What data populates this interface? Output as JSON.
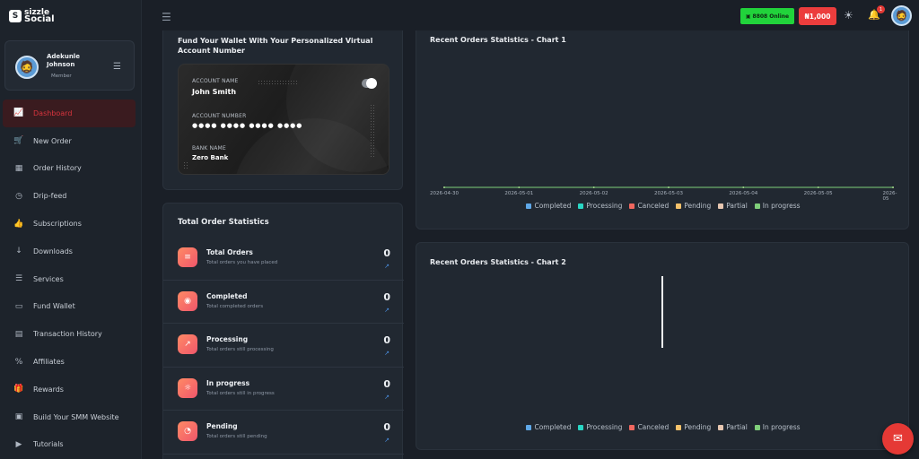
{
  "brand": {
    "logo_top": "sizzle",
    "logo_bottom": "Social",
    "logo_mark": "S"
  },
  "user": {
    "name": "Adekunle Johnson",
    "role": "Member"
  },
  "sidebar": {
    "items": [
      {
        "label": "Dashboard",
        "icon": "chart-icon",
        "glyph": "📈"
      },
      {
        "label": "New Order",
        "icon": "cart-icon",
        "glyph": "🛒"
      },
      {
        "label": "Order History",
        "icon": "calendar-icon",
        "glyph": "▦"
      },
      {
        "label": "Drip-feed",
        "icon": "clock-icon",
        "glyph": "◷"
      },
      {
        "label": "Subscriptions",
        "icon": "thumbs-up-icon",
        "glyph": "👍"
      },
      {
        "label": "Downloads",
        "icon": "download-icon",
        "glyph": "↓"
      },
      {
        "label": "Services",
        "icon": "list-icon",
        "glyph": "☰"
      },
      {
        "label": "Fund Wallet",
        "icon": "wallet-icon",
        "glyph": "▭"
      },
      {
        "label": "Transaction History",
        "icon": "file-icon",
        "glyph": "▤"
      },
      {
        "label": "Affiliates",
        "icon": "percent-icon",
        "glyph": "%"
      },
      {
        "label": "Rewards",
        "icon": "gift-icon",
        "glyph": "🎁"
      },
      {
        "label": "Build Your SMM Website",
        "icon": "build-icon",
        "glyph": "▣"
      },
      {
        "label": "Tutorials",
        "icon": "play-circle-icon",
        "glyph": "▶"
      }
    ]
  },
  "topbar": {
    "online_count": "8808 Online",
    "balance": "₦1,000",
    "notification_count": "1"
  },
  "wallet": {
    "title": "Fund Your Wallet With Your Personalized Virtual Account Number",
    "account_name_label": "ACCOUNT NAME",
    "account_name": "John Smith",
    "account_number_label": "ACCOUNT NUMBER",
    "account_number_masked": "●●●● ●●●● ●●●● ●●●●",
    "bank_name_label": "BANK NAME",
    "bank_name": "Zero Bank"
  },
  "stats": {
    "title": "Total Order Statistics",
    "rows": [
      {
        "name": "Total Orders",
        "desc": "Total orders you have placed",
        "value": "0",
        "icon": "list-icon",
        "glyph": "≡"
      },
      {
        "name": "Completed",
        "desc": "Total completed orders",
        "value": "0",
        "icon": "check-icon",
        "glyph": "◉"
      },
      {
        "name": "Processing",
        "desc": "Total orders still processing",
        "value": "0",
        "icon": "trend-icon",
        "glyph": "↗"
      },
      {
        "name": "In progress",
        "desc": "Total orders still in progress",
        "value": "0",
        "icon": "sun-icon",
        "glyph": "☼"
      },
      {
        "name": "Pending",
        "desc": "Total orders still pending",
        "value": "0",
        "icon": "timer-icon",
        "glyph": "◔"
      }
    ]
  },
  "colors": {
    "completed": "#5fa8e8",
    "processing": "#29d6c4",
    "canceled": "#f0675f",
    "pending": "#f5c26b",
    "partial": "#e6c6b0",
    "in_progress": "#7fcf7a"
  },
  "chart_data": [
    {
      "type": "line",
      "title": "Recent Orders Statistics - Chart 1",
      "x": [
        "2026-04-30",
        "2026-05-01",
        "2026-05-02",
        "2026-05-03",
        "2026-05-04",
        "2026-05-05",
        "2026-05-06"
      ],
      "x_tick_labels": [
        "2026-04-30",
        "2026-05-01",
        "2026-05-02",
        "2026-05-03",
        "2026-05-04",
        "2026-05-05",
        "2026-05"
      ],
      "series": [
        {
          "name": "Completed",
          "values": [
            0,
            0,
            0,
            0,
            0,
            0,
            0
          ]
        },
        {
          "name": "Processing",
          "values": [
            0,
            0,
            0,
            0,
            0,
            0,
            0
          ]
        },
        {
          "name": "Canceled",
          "values": [
            0,
            0,
            0,
            0,
            0,
            0,
            0
          ]
        },
        {
          "name": "Pending",
          "values": [
            0,
            0,
            0,
            0,
            0,
            0,
            0
          ]
        },
        {
          "name": "Partial",
          "values": [
            0,
            0,
            0,
            0,
            0,
            0,
            0
          ]
        },
        {
          "name": "In progress",
          "values": [
            0,
            0,
            0,
            0,
            0,
            0,
            0
          ]
        }
      ],
      "legend": "bottom"
    },
    {
      "type": "bar",
      "title": "Recent Orders Statistics - Chart 2",
      "series": [
        {
          "name": "Completed",
          "values": []
        },
        {
          "name": "Processing",
          "values": []
        },
        {
          "name": "Canceled",
          "values": []
        },
        {
          "name": "Pending",
          "values": []
        },
        {
          "name": "Partial",
          "values": []
        },
        {
          "name": "In progress",
          "values": []
        }
      ],
      "legend": "bottom"
    }
  ]
}
